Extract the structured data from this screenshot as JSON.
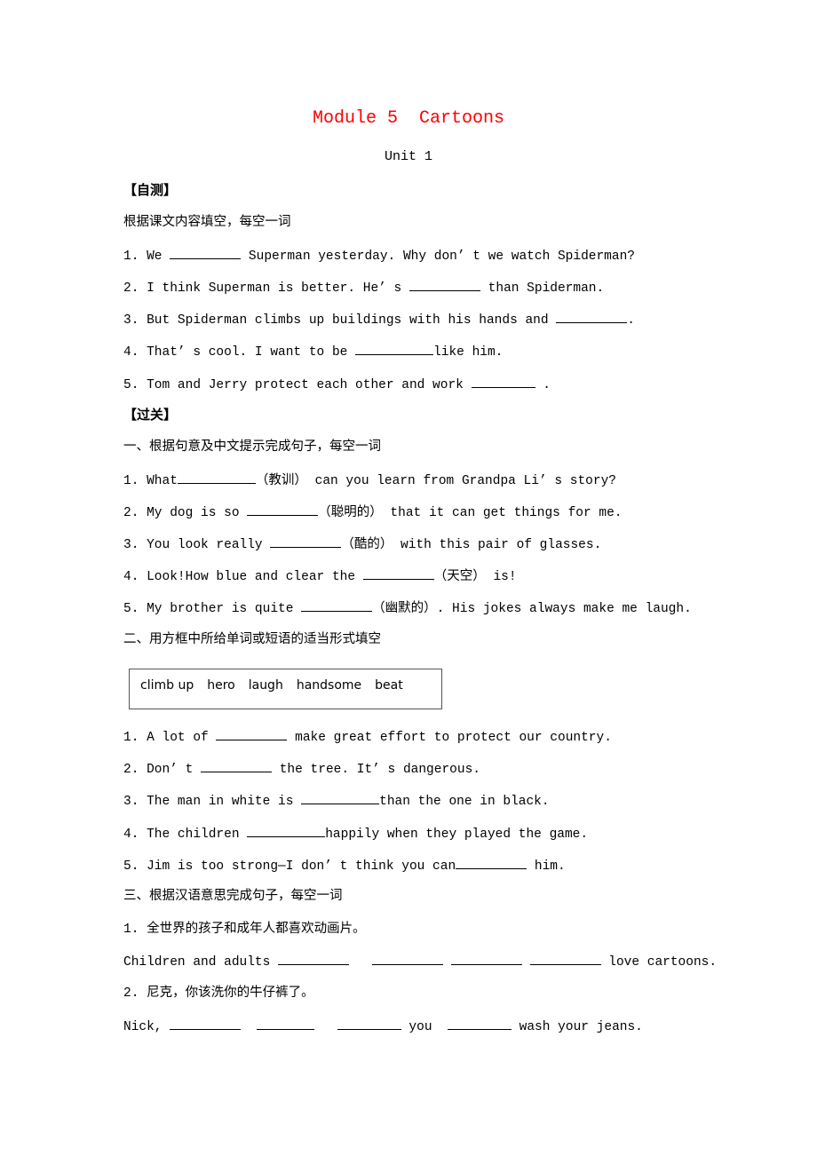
{
  "title": "Module 5  Cartoons",
  "unit": "Unit 1",
  "self_test": {
    "heading": "【自测】",
    "instruction": "根据课文内容填空，每空一词",
    "items": [
      {
        "num": "1.",
        "before": "We ",
        "after": " Superman yesterday. Why don’ t we watch Spiderman?"
      },
      {
        "num": "2.",
        "before": "I think Superman is better. He’ s ",
        "after": " than Spiderman."
      },
      {
        "num": "3.",
        "before": "But Spiderman climbs up buildings with his hands and ",
        "after": "."
      },
      {
        "num": "4.",
        "before": "That’ s cool. I want to be ",
        "after": "like him."
      },
      {
        "num": "5.",
        "before": "Tom and Jerry protect each other and work ",
        "after": " ."
      }
    ]
  },
  "pass": {
    "heading": "【过关】",
    "section1": {
      "instruction": "一、根据句意及中文提示完成句子，每空一词",
      "items": [
        {
          "num": "1.",
          "before": "What",
          "hint": "（教训）",
          "after": " can you learn from Grandpa Li’ s story?"
        },
        {
          "num": "2.",
          "before": "My dog is so ",
          "hint": "（聪明的）",
          "after": " that it can get things for me."
        },
        {
          "num": "3.",
          "before": "You look really ",
          "hint": "（酷的）",
          "after": " with this pair of glasses."
        },
        {
          "num": "4.",
          "before": "Look!How blue and clear the ",
          "hint": "（天空）",
          "after": " is!"
        },
        {
          "num": "5.",
          "before": "My brother is quite ",
          "hint": "（幽默的）",
          "after": ". His jokes always make me laugh."
        }
      ]
    },
    "section2": {
      "instruction": "二、用方框中所给单词或短语的适当形式填空",
      "word_box": [
        "climb up",
        "hero",
        "laugh",
        "handsome",
        "beat"
      ],
      "items": [
        {
          "num": "1.",
          "before": "A lot of ",
          "after": " make great effort to protect our country."
        },
        {
          "num": "2.",
          "before": "Don’ t ",
          "after": " the tree. It’ s dangerous."
        },
        {
          "num": "3.",
          "before": "The man in white is ",
          "after": "than the one in black."
        },
        {
          "num": "4.",
          "before": "The children ",
          "after": "happily when they played the game."
        },
        {
          "num": "5.",
          "before": "Jim is too strong—I don’ t think you can",
          "after": " him."
        }
      ]
    },
    "section3": {
      "instruction": "三、根据汉语意思完成句子，每空一词",
      "items": [
        {
          "num": "1.",
          "chinese": "全世界的孩子和成年人都喜欢动画片。",
          "english_before": "Children and adults ",
          "english_after": " love cartoons."
        },
        {
          "num": "2.",
          "chinese": "尼克，你该洗你的牛仔裤了。",
          "english_before": "Nick, ",
          "english_mid": " you ",
          "english_after": " wash your jeans."
        }
      ]
    }
  }
}
